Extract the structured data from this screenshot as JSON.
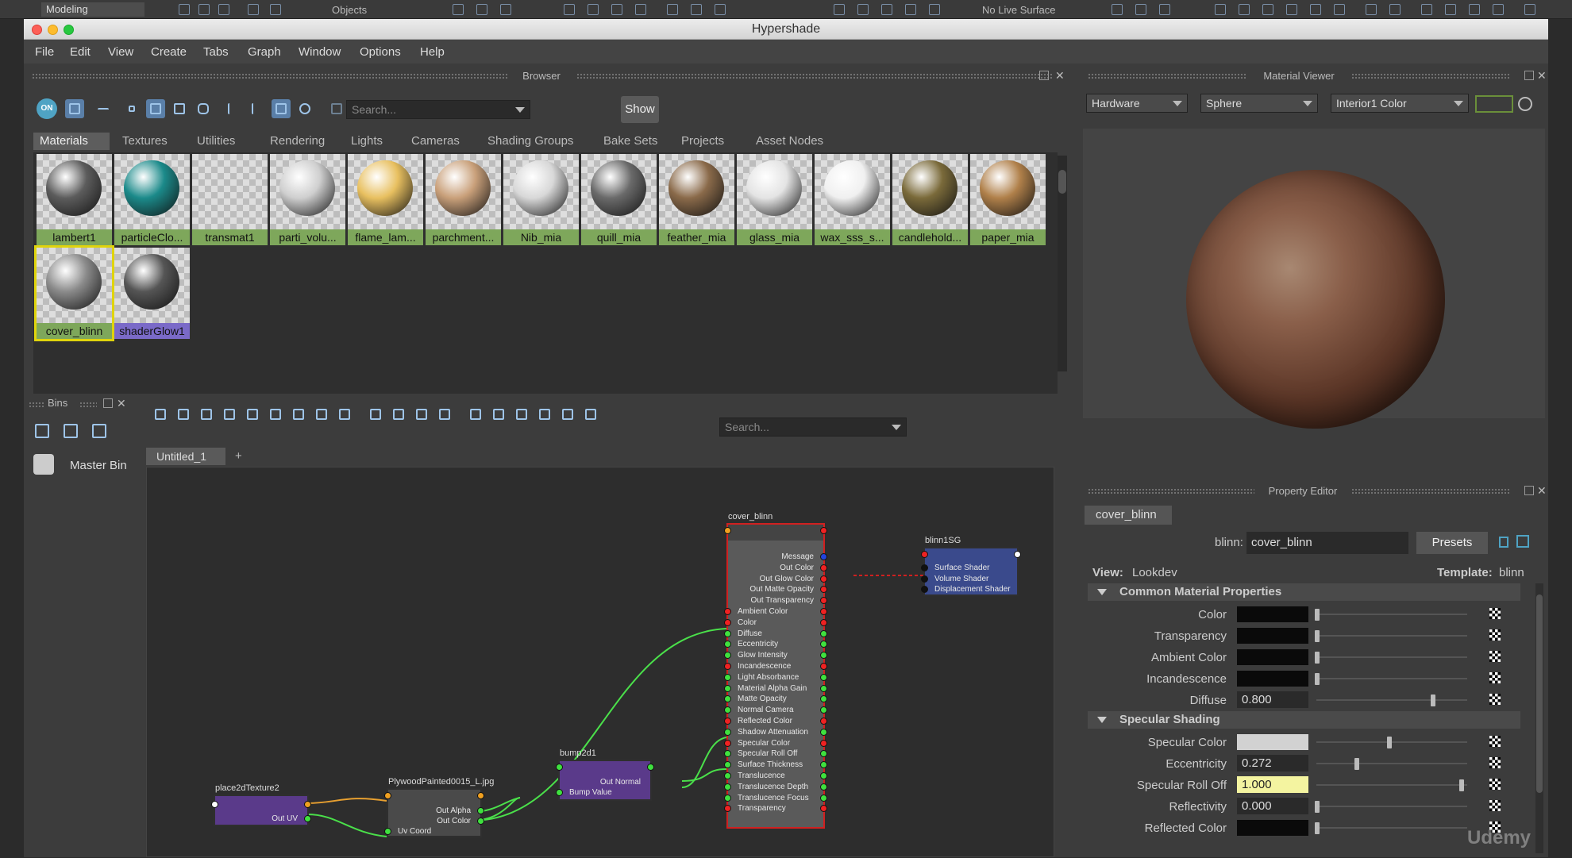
{
  "maya_topbar": {
    "workspace": "Modeling",
    "objects_label": "Objects",
    "live_surface": "No Live Surface"
  },
  "window": {
    "title": "Hypershade"
  },
  "menu": [
    "File",
    "Edit",
    "View",
    "Create",
    "Tabs",
    "Graph",
    "Window",
    "Options",
    "Help"
  ],
  "browser": {
    "title": "Browser",
    "toggle_label": "ON",
    "search_placeholder": "Search...",
    "show_button": "Show",
    "tabs": [
      "Materials",
      "Textures",
      "Utilities",
      "Rendering",
      "Lights",
      "Cameras",
      "Shading Groups",
      "Bake Sets",
      "Projects",
      "Asset Nodes"
    ],
    "selected_tab": "Materials",
    "materials": [
      {
        "label": "lambert1",
        "ball": "#5c5c5c"
      },
      {
        "label": "particleClo...",
        "ball": "#1b8a8a"
      },
      {
        "label": "transmat1",
        "ball": ""
      },
      {
        "label": "parti_volu...",
        "ball": "#cfcfcf"
      },
      {
        "label": "flame_lam...",
        "ball": "#e8c060"
      },
      {
        "label": "parchment...",
        "ball": "#c9a07a"
      },
      {
        "label": "Nib_mia",
        "ball": "#d8d8d8"
      },
      {
        "label": "quill_mia",
        "ball": "#6a6a6a"
      },
      {
        "label": "feather_mia",
        "ball": "#8a6a4a"
      },
      {
        "label": "glass_mia",
        "ball": "#e4e4e4"
      },
      {
        "label": "wax_sss_s...",
        "ball": "#f0f0f0"
      },
      {
        "label": "candlehold...",
        "ball": "#7a6a3a"
      },
      {
        "label": "paper_mia",
        "ball": "#b0804a"
      },
      {
        "label": "cover_blinn",
        "ball": "#8a8a8a"
      },
      {
        "label": "shaderGlow1",
        "ball": "#555"
      }
    ]
  },
  "material_viewer": {
    "title": "Material Viewer",
    "renderer": "Hardware",
    "shape": "Sphere",
    "environment": "Interior1 Color"
  },
  "bins": {
    "title": "Bins",
    "master_bin": "Master Bin"
  },
  "graph": {
    "search_placeholder": "Search...",
    "tab": "Untitled_1",
    "add_tab": "+",
    "nodes": {
      "cover_blinn": {
        "title": "cover_blinn",
        "outputs": [
          "Message",
          "Out Color",
          "Out Glow Color",
          "Out Matte Opacity",
          "Out Transparency"
        ],
        "inputs": [
          "Ambient Color",
          "Color",
          "Diffuse",
          "Eccentricity",
          "Glow Intensity",
          "Incandescence",
          "Light Absorbance",
          "Material Alpha Gain",
          "Matte Opacity",
          "Normal Camera",
          "Reflected Color",
          "Shadow Attenuation",
          "Specular Color",
          "Specular Roll Off",
          "Surface Thickness",
          "Translucence",
          "Translucence Depth",
          "Translucence Focus",
          "Transparency"
        ]
      },
      "blinn1SG": {
        "title": "blinn1SG",
        "attrs": [
          "Surface Shader",
          "Volume Shader",
          "Displacement Shader"
        ]
      },
      "bump2d1": {
        "title": "bump2d1",
        "attrs": [
          "Out Normal",
          "Bump Value"
        ]
      },
      "file": {
        "title": "PlywoodPainted0015_L.jpg",
        "attrs": [
          "Out Alpha",
          "Out Color",
          "Uv Coord"
        ]
      },
      "place2d": {
        "title": "place2dTexture2",
        "attrs": [
          "Out UV"
        ]
      }
    }
  },
  "property_editor": {
    "title": "Property Editor",
    "node_tab": "cover_blinn",
    "type_label": "blinn:",
    "node_name": "cover_blinn",
    "presets": "Presets",
    "view_label": "View:",
    "view": "Lookdev",
    "template_label": "Template:",
    "template": "blinn",
    "sections": [
      {
        "title": "Common Material Properties",
        "rows": [
          {
            "label": "Color",
            "kind": "color",
            "color": "#0a0a0a",
            "slider": 0.0
          },
          {
            "label": "Transparency",
            "kind": "color",
            "color": "#0a0a0a",
            "slider": 0.0
          },
          {
            "label": "Ambient Color",
            "kind": "color",
            "color": "#0a0a0a",
            "slider": 0.0
          },
          {
            "label": "Incandescence",
            "kind": "color",
            "color": "#0a0a0a",
            "slider": 0.0
          },
          {
            "label": "Diffuse",
            "kind": "value",
            "value": "0.800",
            "slider": 0.8
          }
        ]
      },
      {
        "title": "Specular Shading",
        "rows": [
          {
            "label": "Specular Color",
            "kind": "color",
            "color": "#d2d2d2",
            "slider": 0.5
          },
          {
            "label": "Eccentricity",
            "kind": "value",
            "value": "0.272",
            "slider": 0.272
          },
          {
            "label": "Specular Roll Off",
            "kind": "value",
            "value": "1.000",
            "slider": 1.0,
            "highlight": true
          },
          {
            "label": "Reflectivity",
            "kind": "value",
            "value": "0.000",
            "slider": 0.0
          },
          {
            "label": "Reflected Color",
            "kind": "color",
            "color": "#0a0a0a",
            "slider": 0.0
          }
        ]
      }
    ]
  },
  "watermark": "Udemy",
  "colors": {
    "material_label_bg": "#7ea75b",
    "selected_outline": "#e0d40c",
    "node_blinnSG": "#3a4a8c",
    "node_purple": "#5a3a8a",
    "wire_green": "#4ae04a",
    "wire_red": "#d02020"
  }
}
